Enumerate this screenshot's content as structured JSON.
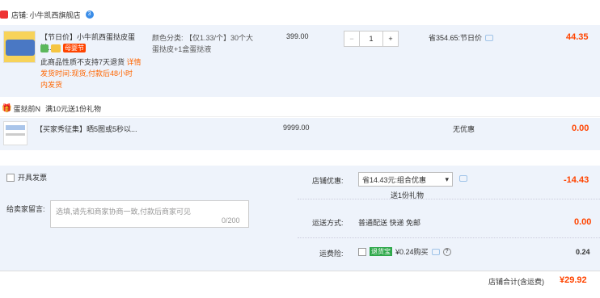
{
  "store": {
    "label": "店铺:",
    "name": "小牛凯西旗舰店",
    "badge": "3"
  },
  "item1": {
    "title_tag": "【节日价】",
    "title": "小牛凯西蛋挞皮蛋挞...",
    "tag_mother": "母婴节",
    "notice1": "此商品性质不支持7天退货",
    "notice1_link": "详情",
    "notice2": "发货时间:现货,付款后48小时",
    "notice3": "内发货",
    "spec_label": "颜色分类:",
    "spec_value": "【仅1.33/个】30个大",
    "spec_value2": "蛋挞皮+1盒蛋挞液",
    "unit_price": "399.00",
    "qty": "1",
    "discount": "省354.65:节日价",
    "subtotal": "44.35"
  },
  "promo": {
    "label": "蛋挞前N",
    "text": "满10元送1份礼物"
  },
  "item2": {
    "title": "【买家秀征集】晒5图或5秒以...",
    "price": "9999.00",
    "discount": "无优惠",
    "subtotal": "0.00"
  },
  "invoice": {
    "label": "开具发票"
  },
  "store_discount": {
    "label": "店铺优惠:",
    "select_value": "省14.43元:组合优惠",
    "sub": "送1份礼物",
    "amount": "-14.43"
  },
  "message": {
    "label": "给卖家留言:",
    "placeholder": "选填,请先和商家协商一致,付款后商家可见",
    "count": "0/200"
  },
  "shipping": {
    "label": "运送方式:",
    "value": "普通配送 快递 免邮",
    "amount": "0.00"
  },
  "insurance": {
    "label": "运费险:",
    "badge": "退货宝",
    "text": "¥0.24购买",
    "amount": "0.24"
  },
  "total": {
    "label": "店铺合计(含运费)",
    "amount": "¥29.92"
  },
  "colors": {
    "accent": "#ff4400",
    "link_blue": "#3a8de8",
    "panel_bg": "#eef3fb"
  }
}
